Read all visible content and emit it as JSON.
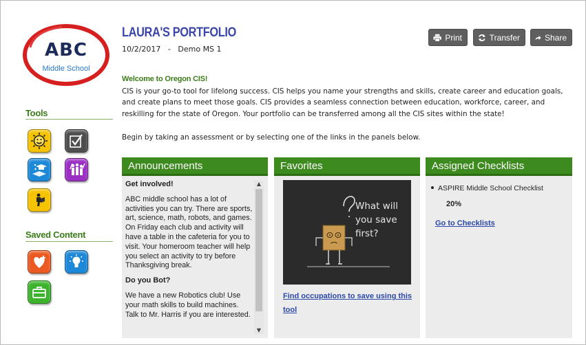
{
  "logo": {
    "text": "ABC",
    "subtitle": "Middle School"
  },
  "sidebar": {
    "tools_title": "Tools",
    "saved_title": "Saved Content",
    "tool_icons": [
      "smiley-sun-icon",
      "checklist-icon",
      "graduation-book-icon",
      "group-people-icon",
      "person-reading-icon"
    ],
    "saved_icons": [
      "heart-icon",
      "lightbulb-icon",
      "briefcase-icon"
    ]
  },
  "header": {
    "title": "LAURA'S PORTFOLIO",
    "date": "10/2/2017",
    "separator": "-",
    "site": "Demo MS 1"
  },
  "toolbar": {
    "print_label": "Print",
    "transfer_label": "Transfer",
    "share_label": "Share"
  },
  "welcome": {
    "title": "Welcome to Oregon CIS!",
    "body": "CIS is your go-to tool for lifelong success. CIS helps you name your strengths and skills, create career and education goals, and create plans to meet those goals. CIS provides a seamless connection between education, workforce, career, and reskilling for the state of Oregon. Your portfolio can be transferred among all the CIS sites within the state!",
    "begin": "Begin by taking an assessment or by selecting one of the links in the panels below."
  },
  "announcements": {
    "title": "Announcements",
    "items": [
      {
        "heading": "Get involved!",
        "body": "ABC middle school has a lot of activities you can try.  There are sports, art, science, math, robots, and games.  On Friday each club and activity will have a table in the cafeteria for you to visit.  Your homeroom teacher will help you select an activity to try before Thanksgiving break."
      },
      {
        "heading": "Do you Bot?",
        "body": "We have a new Robotics club!  Use your math skills to build machines.  Talk to Mr. Harris if you are interested."
      }
    ]
  },
  "favorites": {
    "title": "Favorites",
    "image_text": "What will you save first?",
    "link": "Find occupations to save using this tool"
  },
  "checklists": {
    "title": "Assigned Checklists",
    "item": "ASPIRE Middle School Checklist",
    "progress": "20%",
    "link": "Go to Checklists"
  },
  "colors": {
    "panel_header": "#3d8a1f",
    "section_title": "#3b7c19",
    "portfolio_title": "#3a46a8",
    "link": "#2c49a8",
    "button": "#5f5f5f"
  }
}
